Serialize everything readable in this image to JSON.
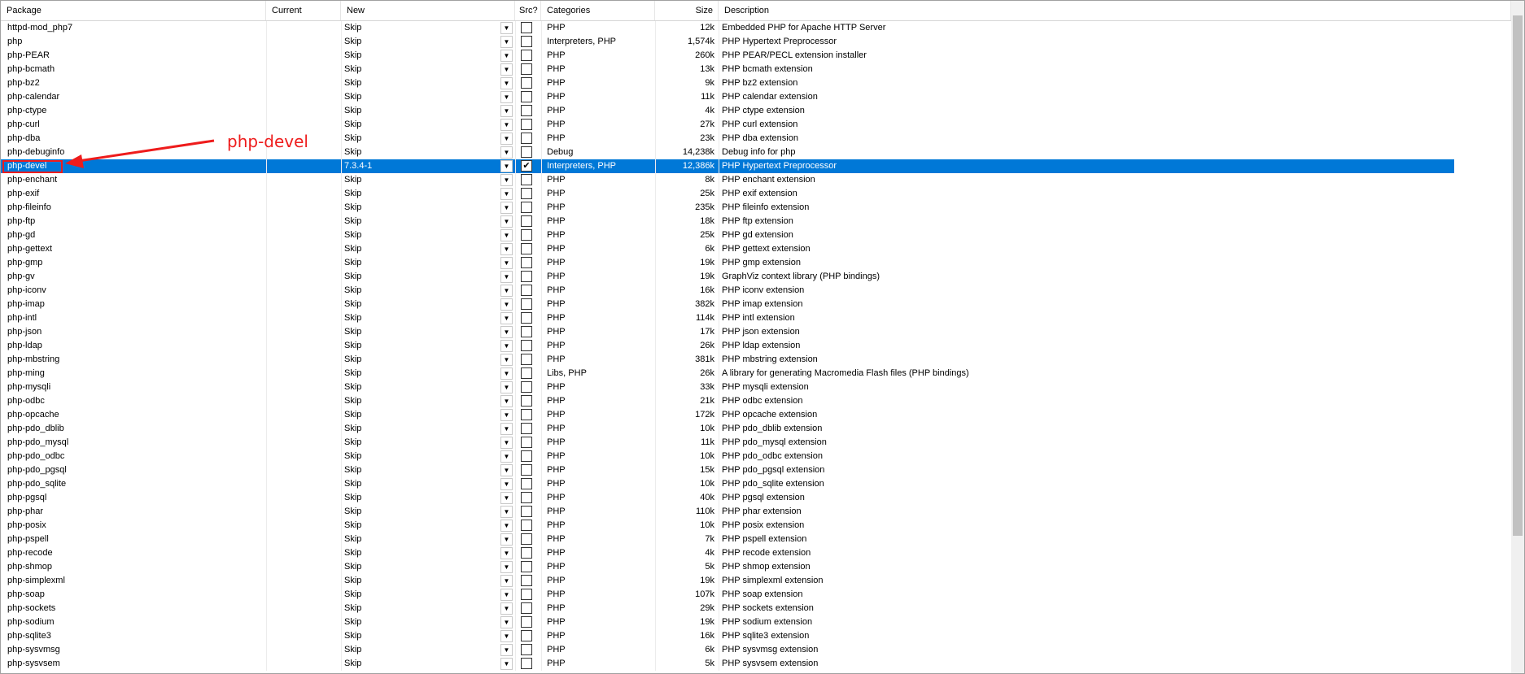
{
  "columns": {
    "package": "Package",
    "current": "Current",
    "new": "New",
    "src": "Src?",
    "categories": "Categories",
    "size": "Size",
    "description": "Description"
  },
  "annotation": {
    "label": "php-devel",
    "color": "#ee1c1c"
  },
  "selection_color": "#0078d7",
  "rows": [
    {
      "package": "httpd-mod_php7",
      "current": "",
      "new": "Skip",
      "src": false,
      "categories": "PHP",
      "size": "12k",
      "description": "Embedded PHP for Apache HTTP Server"
    },
    {
      "package": "php",
      "current": "",
      "new": "Skip",
      "src": false,
      "categories": "Interpreters, PHP",
      "size": "1,574k",
      "description": "PHP Hypertext Preprocessor"
    },
    {
      "package": "php-PEAR",
      "current": "",
      "new": "Skip",
      "src": false,
      "categories": "PHP",
      "size": "260k",
      "description": "PHP PEAR/PECL extension installer"
    },
    {
      "package": "php-bcmath",
      "current": "",
      "new": "Skip",
      "src": false,
      "categories": "PHP",
      "size": "13k",
      "description": "PHP bcmath extension"
    },
    {
      "package": "php-bz2",
      "current": "",
      "new": "Skip",
      "src": false,
      "categories": "PHP",
      "size": "9k",
      "description": "PHP bz2 extension"
    },
    {
      "package": "php-calendar",
      "current": "",
      "new": "Skip",
      "src": false,
      "categories": "PHP",
      "size": "11k",
      "description": "PHP calendar extension"
    },
    {
      "package": "php-ctype",
      "current": "",
      "new": "Skip",
      "src": false,
      "categories": "PHP",
      "size": "4k",
      "description": "PHP ctype extension"
    },
    {
      "package": "php-curl",
      "current": "",
      "new": "Skip",
      "src": false,
      "categories": "PHP",
      "size": "27k",
      "description": "PHP curl extension"
    },
    {
      "package": "php-dba",
      "current": "",
      "new": "Skip",
      "src": false,
      "categories": "PHP",
      "size": "23k",
      "description": "PHP dba extension"
    },
    {
      "package": "php-debuginfo",
      "current": "",
      "new": "Skip",
      "src": false,
      "categories": "Debug",
      "size": "14,238k",
      "description": "Debug info for php"
    },
    {
      "package": "php-devel",
      "current": "",
      "new": "7.3.4-1",
      "src": true,
      "categories": "Interpreters, PHP",
      "size": "12,386k",
      "description": "PHP Hypertext Preprocessor",
      "selected": true
    },
    {
      "package": "php-enchant",
      "current": "",
      "new": "Skip",
      "src": false,
      "categories": "PHP",
      "size": "8k",
      "description": "PHP enchant extension"
    },
    {
      "package": "php-exif",
      "current": "",
      "new": "Skip",
      "src": false,
      "categories": "PHP",
      "size": "25k",
      "description": "PHP exif extension"
    },
    {
      "package": "php-fileinfo",
      "current": "",
      "new": "Skip",
      "src": false,
      "categories": "PHP",
      "size": "235k",
      "description": "PHP fileinfo extension"
    },
    {
      "package": "php-ftp",
      "current": "",
      "new": "Skip",
      "src": false,
      "categories": "PHP",
      "size": "18k",
      "description": "PHP ftp extension"
    },
    {
      "package": "php-gd",
      "current": "",
      "new": "Skip",
      "src": false,
      "categories": "PHP",
      "size": "25k",
      "description": "PHP gd extension"
    },
    {
      "package": "php-gettext",
      "current": "",
      "new": "Skip",
      "src": false,
      "categories": "PHP",
      "size": "6k",
      "description": "PHP gettext extension"
    },
    {
      "package": "php-gmp",
      "current": "",
      "new": "Skip",
      "src": false,
      "categories": "PHP",
      "size": "19k",
      "description": "PHP gmp extension"
    },
    {
      "package": "php-gv",
      "current": "",
      "new": "Skip",
      "src": false,
      "categories": "PHP",
      "size": "19k",
      "description": "GraphViz context library (PHP bindings)"
    },
    {
      "package": "php-iconv",
      "current": "",
      "new": "Skip",
      "src": false,
      "categories": "PHP",
      "size": "16k",
      "description": "PHP iconv extension"
    },
    {
      "package": "php-imap",
      "current": "",
      "new": "Skip",
      "src": false,
      "categories": "PHP",
      "size": "382k",
      "description": "PHP imap extension"
    },
    {
      "package": "php-intl",
      "current": "",
      "new": "Skip",
      "src": false,
      "categories": "PHP",
      "size": "114k",
      "description": "PHP intl extension"
    },
    {
      "package": "php-json",
      "current": "",
      "new": "Skip",
      "src": false,
      "categories": "PHP",
      "size": "17k",
      "description": "PHP json extension"
    },
    {
      "package": "php-ldap",
      "current": "",
      "new": "Skip",
      "src": false,
      "categories": "PHP",
      "size": "26k",
      "description": "PHP ldap extension"
    },
    {
      "package": "php-mbstring",
      "current": "",
      "new": "Skip",
      "src": false,
      "categories": "PHP",
      "size": "381k",
      "description": "PHP mbstring extension"
    },
    {
      "package": "php-ming",
      "current": "",
      "new": "Skip",
      "src": false,
      "categories": "Libs, PHP",
      "size": "26k",
      "description": "A library for generating Macromedia Flash files (PHP bindings)"
    },
    {
      "package": "php-mysqli",
      "current": "",
      "new": "Skip",
      "src": false,
      "categories": "PHP",
      "size": "33k",
      "description": "PHP mysqli extension"
    },
    {
      "package": "php-odbc",
      "current": "",
      "new": "Skip",
      "src": false,
      "categories": "PHP",
      "size": "21k",
      "description": "PHP odbc extension"
    },
    {
      "package": "php-opcache",
      "current": "",
      "new": "Skip",
      "src": false,
      "categories": "PHP",
      "size": "172k",
      "description": "PHP opcache extension"
    },
    {
      "package": "php-pdo_dblib",
      "current": "",
      "new": "Skip",
      "src": false,
      "categories": "PHP",
      "size": "10k",
      "description": "PHP pdo_dblib extension"
    },
    {
      "package": "php-pdo_mysql",
      "current": "",
      "new": "Skip",
      "src": false,
      "categories": "PHP",
      "size": "11k",
      "description": "PHP pdo_mysql extension"
    },
    {
      "package": "php-pdo_odbc",
      "current": "",
      "new": "Skip",
      "src": false,
      "categories": "PHP",
      "size": "10k",
      "description": "PHP pdo_odbc extension"
    },
    {
      "package": "php-pdo_pgsql",
      "current": "",
      "new": "Skip",
      "src": false,
      "categories": "PHP",
      "size": "15k",
      "description": "PHP pdo_pgsql extension"
    },
    {
      "package": "php-pdo_sqlite",
      "current": "",
      "new": "Skip",
      "src": false,
      "categories": "PHP",
      "size": "10k",
      "description": "PHP pdo_sqlite extension"
    },
    {
      "package": "php-pgsql",
      "current": "",
      "new": "Skip",
      "src": false,
      "categories": "PHP",
      "size": "40k",
      "description": "PHP pgsql extension"
    },
    {
      "package": "php-phar",
      "current": "",
      "new": "Skip",
      "src": false,
      "categories": "PHP",
      "size": "110k",
      "description": "PHP phar extension"
    },
    {
      "package": "php-posix",
      "current": "",
      "new": "Skip",
      "src": false,
      "categories": "PHP",
      "size": "10k",
      "description": "PHP posix extension"
    },
    {
      "package": "php-pspell",
      "current": "",
      "new": "Skip",
      "src": false,
      "categories": "PHP",
      "size": "7k",
      "description": "PHP pspell extension"
    },
    {
      "package": "php-recode",
      "current": "",
      "new": "Skip",
      "src": false,
      "categories": "PHP",
      "size": "4k",
      "description": "PHP recode extension"
    },
    {
      "package": "php-shmop",
      "current": "",
      "new": "Skip",
      "src": false,
      "categories": "PHP",
      "size": "5k",
      "description": "PHP shmop extension"
    },
    {
      "package": "php-simplexml",
      "current": "",
      "new": "Skip",
      "src": false,
      "categories": "PHP",
      "size": "19k",
      "description": "PHP simplexml extension"
    },
    {
      "package": "php-soap",
      "current": "",
      "new": "Skip",
      "src": false,
      "categories": "PHP",
      "size": "107k",
      "description": "PHP soap extension"
    },
    {
      "package": "php-sockets",
      "current": "",
      "new": "Skip",
      "src": false,
      "categories": "PHP",
      "size": "29k",
      "description": "PHP sockets extension"
    },
    {
      "package": "php-sodium",
      "current": "",
      "new": "Skip",
      "src": false,
      "categories": "PHP",
      "size": "19k",
      "description": "PHP sodium extension"
    },
    {
      "package": "php-sqlite3",
      "current": "",
      "new": "Skip",
      "src": false,
      "categories": "PHP",
      "size": "16k",
      "description": "PHP sqlite3 extension"
    },
    {
      "package": "php-sysvmsg",
      "current": "",
      "new": "Skip",
      "src": false,
      "categories": "PHP",
      "size": "6k",
      "description": "PHP sysvmsg extension"
    },
    {
      "package": "php-sysvsem",
      "current": "",
      "new": "Skip",
      "src": false,
      "categories": "PHP",
      "size": "5k",
      "description": "PHP sysvsem extension"
    }
  ]
}
